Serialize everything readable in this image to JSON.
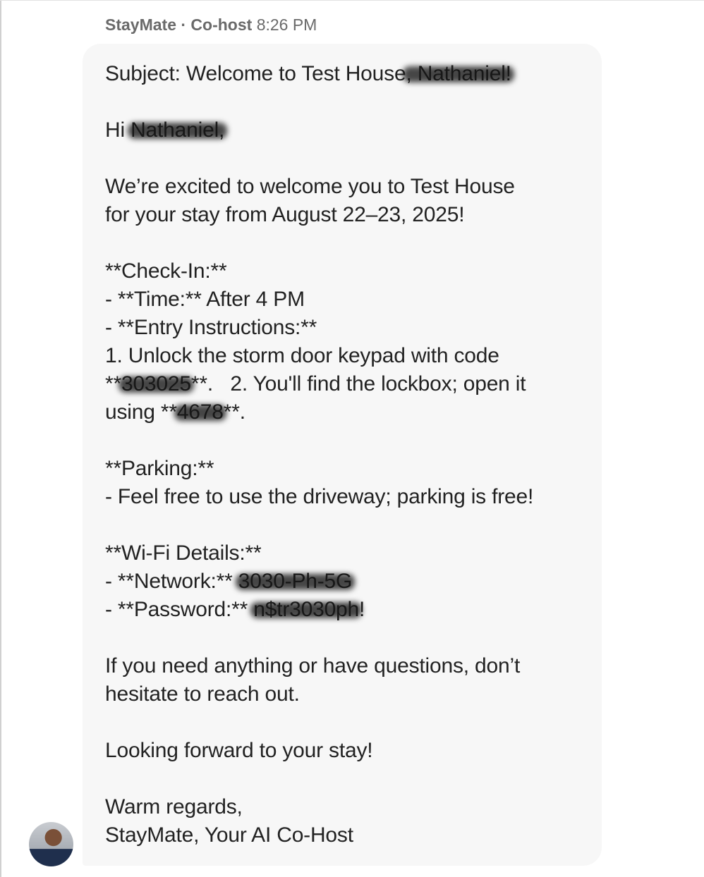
{
  "header": {
    "sender": "StayMate · Co-host",
    "time": "8:26 PM"
  },
  "message": {
    "lines": [
      [
        {
          "t": "Subject: Welcome to Test House"
        },
        {
          "t": ", Nathaniel!",
          "redacted": true
        }
      ],
      [],
      [
        {
          "t": "Hi "
        },
        {
          "t": "Nathaniel,",
          "redacted": true
        }
      ],
      [],
      [
        {
          "t": "We’re excited to welcome you to Test House"
        }
      ],
      [
        {
          "t": "for your stay from August 22–23, 2025!"
        }
      ],
      [],
      [
        {
          "t": "**Check-In:**"
        }
      ],
      [
        {
          "t": "- **Time:** After 4 PM"
        }
      ],
      [
        {
          "t": "- **Entry Instructions:**"
        }
      ],
      [
        {
          "t": "1. Unlock the storm door keypad with code"
        }
      ],
      [
        {
          "t": "**"
        },
        {
          "t": "303025",
          "redacted": true
        },
        {
          "t": "**.   2. You'll find the lockbox; open it"
        }
      ],
      [
        {
          "t": "using **"
        },
        {
          "t": "4678",
          "redacted": true
        },
        {
          "t": "**."
        }
      ],
      [],
      [
        {
          "t": "**Parking:**"
        }
      ],
      [
        {
          "t": "- Feel free to use the driveway; parking is free!"
        }
      ],
      [],
      [
        {
          "t": "**Wi-Fi Details:**"
        }
      ],
      [
        {
          "t": "- **Network:** "
        },
        {
          "t": "3030-Ph-5G",
          "redacted": true
        }
      ],
      [
        {
          "t": "- **Password:** "
        },
        {
          "t": "n$tr3030ph",
          "redacted": true
        },
        {
          "t": "!"
        }
      ],
      [],
      [
        {
          "t": "If you need anything or have questions, don’t"
        }
      ],
      [
        {
          "t": "hesitate to reach out."
        }
      ],
      [],
      [
        {
          "t": "Looking forward to your stay!"
        }
      ],
      [],
      [
        {
          "t": "Warm regards,"
        }
      ],
      [
        {
          "t": "StayMate, Your AI Co-Host"
        }
      ]
    ]
  },
  "avatar": {
    "icon": "host-avatar-photo"
  },
  "colors": {
    "bubble": "#f7f7f7",
    "text": "#222222",
    "meta": "#6a6a6a"
  }
}
